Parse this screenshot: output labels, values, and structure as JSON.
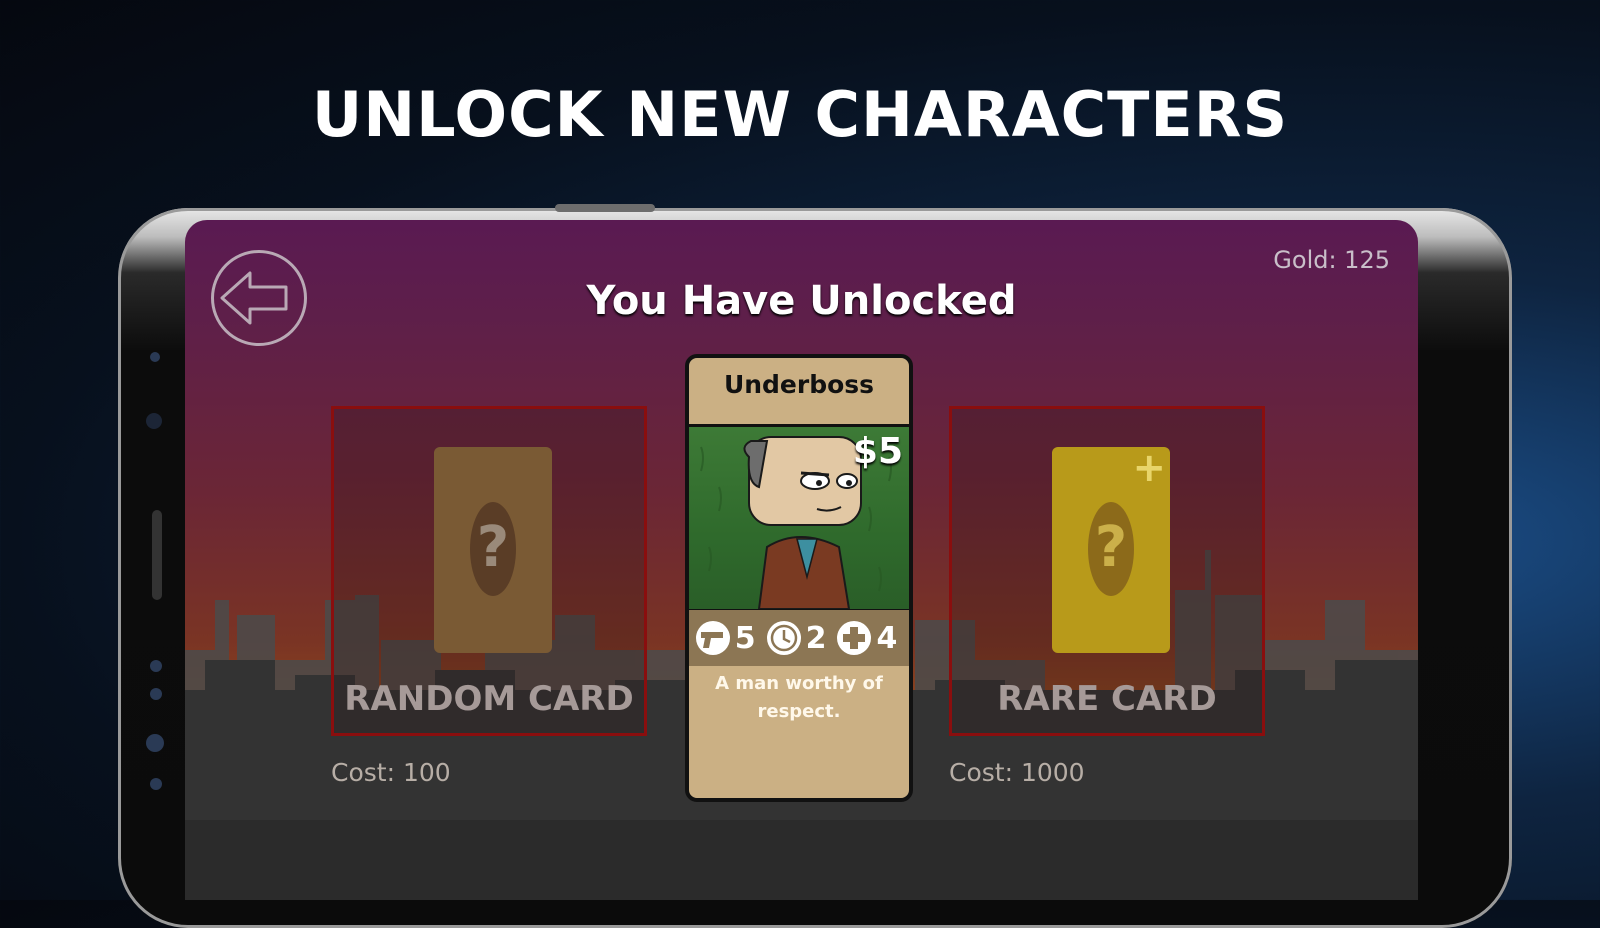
{
  "promo": {
    "title": "UNLOCK NEW CHARACTERS"
  },
  "screen": {
    "title": "You Have Unlocked",
    "gold": "Gold: 125"
  },
  "offers": {
    "random": {
      "label": "RANDOM CARD",
      "cost": "Cost: 100",
      "symbol": "?"
    },
    "rare": {
      "label": "RARE CARD",
      "cost": "Cost: 1000",
      "symbol": "?",
      "badge": "+"
    }
  },
  "character": {
    "name": "Underboss",
    "price": "$5",
    "stats": {
      "attack": "5",
      "time": "2",
      "health": "4"
    },
    "description": "A man worthy of respect."
  },
  "icons": {
    "back": "arrow-left-circle-icon",
    "attack": "gun-icon",
    "time": "clock-icon",
    "health": "plus-cross-icon"
  },
  "colors": {
    "offer_border": "#8a0e0e",
    "card_tan": "#cbb084",
    "rare_card": "#b89a1a"
  }
}
